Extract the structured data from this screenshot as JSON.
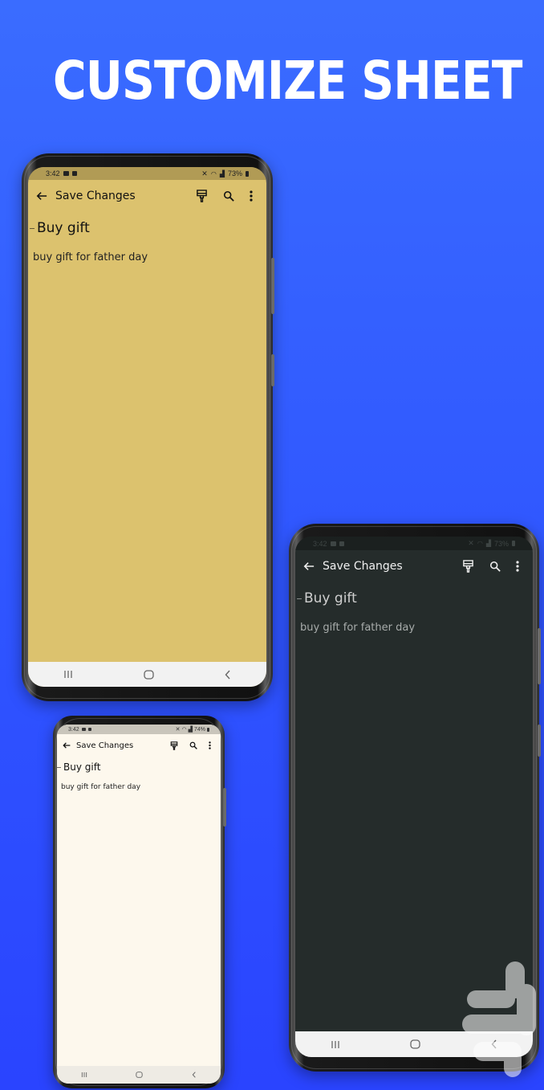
{
  "page": {
    "headline": "CUSTOMIZE SHEET"
  },
  "colors": {
    "background_top": "#3a6cff",
    "background_bottom": "#2a44ff",
    "theme_yellow": "#dcc26e",
    "theme_dark": "#252c2b",
    "theme_cream": "#fdf8ed"
  },
  "phones": [
    {
      "theme": "yellow",
      "status": {
        "time": "3:42",
        "battery": "73%"
      },
      "toolbar": {
        "back_icon": "arrow-left-icon",
        "title": "Save Changes",
        "actions": [
          "paint-brush-icon",
          "search-icon",
          "more-vert-icon"
        ]
      },
      "note": {
        "title": "Buy gift",
        "body": "buy gift for father day"
      },
      "nav": [
        "recent-apps-icon",
        "home-icon",
        "back-icon"
      ]
    },
    {
      "theme": "dark",
      "status": {
        "time": "3:42",
        "battery": "73%"
      },
      "toolbar": {
        "back_icon": "arrow-left-icon",
        "title": "Save Changes",
        "actions": [
          "paint-brush-icon",
          "search-icon",
          "more-vert-icon"
        ]
      },
      "note": {
        "title": "Buy gift",
        "body": "buy gift for father day"
      },
      "nav": [
        "recent-apps-icon",
        "home-icon",
        "back-icon"
      ]
    },
    {
      "theme": "cream",
      "status": {
        "time": "3:42",
        "battery": "74%"
      },
      "toolbar": {
        "back_icon": "arrow-left-icon",
        "title": "Save Changes",
        "actions": [
          "paint-brush-icon",
          "search-icon",
          "more-vert-icon"
        ]
      },
      "note": {
        "title": "Buy gift",
        "body": "buy gift for father day"
      },
      "nav": [
        "recent-apps-icon",
        "home-icon",
        "back-icon"
      ]
    }
  ]
}
